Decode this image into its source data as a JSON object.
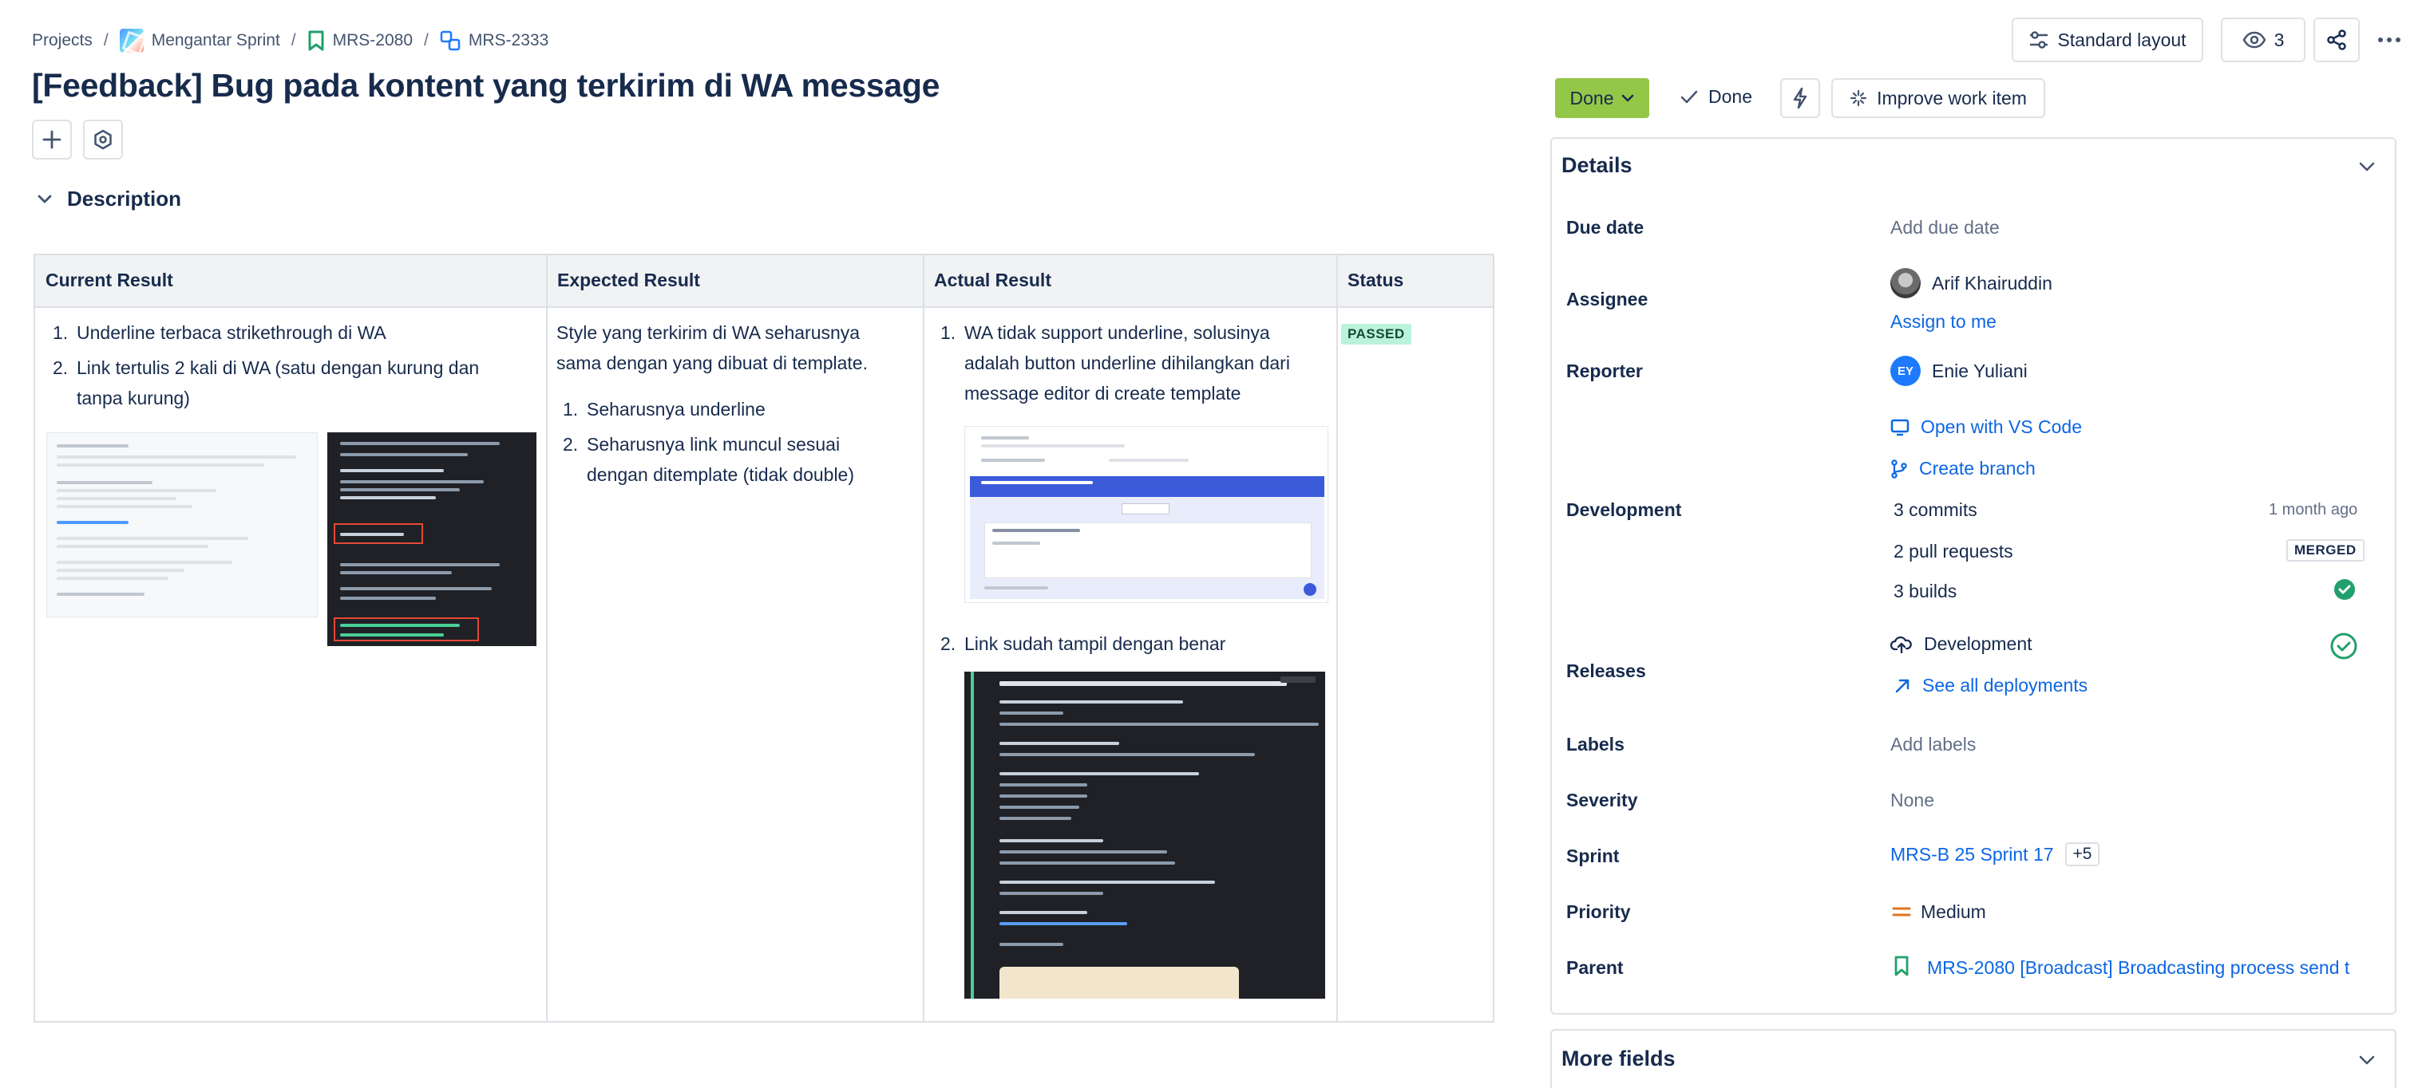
{
  "breadcrumb": {
    "projects": "Projects",
    "project": "Mengantar Sprint",
    "epic": "MRS-2080",
    "issue": "MRS-2333"
  },
  "toolbar": {
    "layout_label": "Standard layout",
    "watch_count": "3"
  },
  "issue": {
    "title": "[Feedback] Bug pada kontent yang terkirim di WA message"
  },
  "description": {
    "heading": "Description",
    "columns": [
      "Current Result",
      "Expected Result",
      "Actual Result",
      "Status"
    ],
    "current": {
      "items": [
        "Underline terbaca strikethrough di WA",
        "Link tertulis 2 kali di WA (satu dengan kurung dan tanpa kurung)"
      ]
    },
    "expected": {
      "intro": "Style yang terkirim di WA seharusnya sama dengan yang dibuat di template.",
      "items": [
        "Seharusnya underline",
        "Seharusnya link muncul sesuai dengan ditemplate (tidak double)"
      ]
    },
    "actual": {
      "items": [
        "WA tidak support underline, solusinya adalah button underline dihilangkan dari message editor di create template",
        "Link sudah tampil dengan benar"
      ]
    },
    "status": "PASSED"
  },
  "status_bar": {
    "status_button": "Done",
    "resolution": "Done",
    "improve_label": "Improve work item"
  },
  "details": {
    "heading": "Details",
    "due_date": {
      "label": "Due date",
      "value": "Add due date"
    },
    "assignee": {
      "label": "Assignee",
      "value": "Arif Khairuddin",
      "assign_link": "Assign to me"
    },
    "reporter": {
      "label": "Reporter",
      "initials": "EY",
      "value": "Enie Yuliani"
    },
    "development": {
      "label": "Development",
      "open_vscode": "Open with VS Code",
      "create_branch": "Create branch",
      "commits": "3 commits",
      "commits_time": "1 month ago",
      "pull_requests": "2 pull requests",
      "pr_status": "MERGED",
      "builds": "3 builds"
    },
    "releases": {
      "label": "Releases",
      "environment": "Development",
      "see_all": "See all deployments"
    },
    "labels": {
      "label": "Labels",
      "value": "Add labels"
    },
    "severity": {
      "label": "Severity",
      "value": "None"
    },
    "sprint": {
      "label": "Sprint",
      "value": "MRS-B 25 Sprint 17",
      "extra": "+5"
    },
    "priority": {
      "label": "Priority",
      "value": "Medium"
    },
    "parent": {
      "label": "Parent",
      "value": "MRS-2080 [Broadcast] Broadcasting process send t"
    }
  },
  "more_fields": {
    "heading": "More fields"
  },
  "colors": {
    "link": "#0c66e4",
    "done_green": "#94c748",
    "passed_bg": "#baf3db",
    "success": "#22a06b",
    "priority_medium": "#e2731d"
  }
}
